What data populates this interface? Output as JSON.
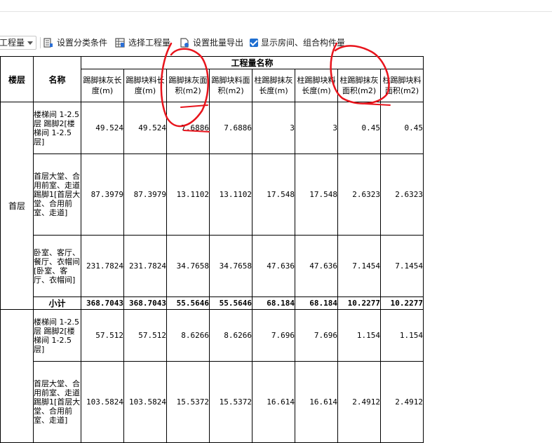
{
  "toolbar": {
    "dropdown_label": "工程量",
    "set_classification_label": "设置分类条件",
    "select_quantity_label": "选择工程量",
    "batch_export_label": "设置批量导出",
    "show_rooms_label": "显示房间、组合构件量"
  },
  "table": {
    "col_floor": "楼层",
    "col_name": "名称",
    "group_header": "工程量名称",
    "columns": [
      "踢脚抹灰长度(m)",
      "踢脚块料长度(m)",
      "踢脚抹灰面积(m2)",
      "踢脚块料面积(m2)",
      "柱踢脚抹灰长度(m)",
      "柱踢脚块料长度(m)",
      "柱踢脚抹灰面积(m2)",
      "柱踢脚块料面积(m2)"
    ],
    "floor1": "首层",
    "subtotal_label": "小计",
    "rows_floor1": [
      {
        "name": "楼梯间 1-2.5层 踢脚2[楼梯间 1-2.5层]",
        "values": [
          "49.524",
          "49.524",
          "7.6886",
          "7.6886",
          "3",
          "3",
          "0.45",
          "0.45"
        ]
      },
      {
        "name": "首层大堂、合用前室、走道 踢脚1[首层大堂、合用前室、走道]",
        "values": [
          "87.3979",
          "87.3979",
          "13.1102",
          "13.1102",
          "17.548",
          "17.548",
          "2.6323",
          "2.6323"
        ]
      },
      {
        "name": "卧室、客厅、餐厅、衣帽间[卧室、客厅、衣帽间]",
        "values": [
          "231.7824",
          "231.7824",
          "34.7658",
          "34.7658",
          "47.636",
          "47.636",
          "7.1454",
          "7.1454"
        ]
      }
    ],
    "subtotal_values": [
      "368.7043",
      "368.7043",
      "55.5646",
      "55.5646",
      "68.184",
      "68.184",
      "10.2277",
      "10.2277"
    ],
    "rows_floor2": [
      {
        "name": "楼梯间 1-2.5层 踢脚2[楼梯间 1-2.5层]",
        "values": [
          "57.512",
          "57.512",
          "8.6266",
          "8.6266",
          "7.696",
          "7.696",
          "1.154",
          "1.154"
        ]
      },
      {
        "name": "首层大堂、合用前室、走道 踢脚1[首层大堂、合用前室、走道]",
        "values": [
          "103.5824",
          "103.5824",
          "15.5372",
          "15.5372",
          "16.614",
          "16.614",
          "2.4912",
          "2.4912"
        ]
      }
    ]
  },
  "annotation_color": "#e8141c"
}
